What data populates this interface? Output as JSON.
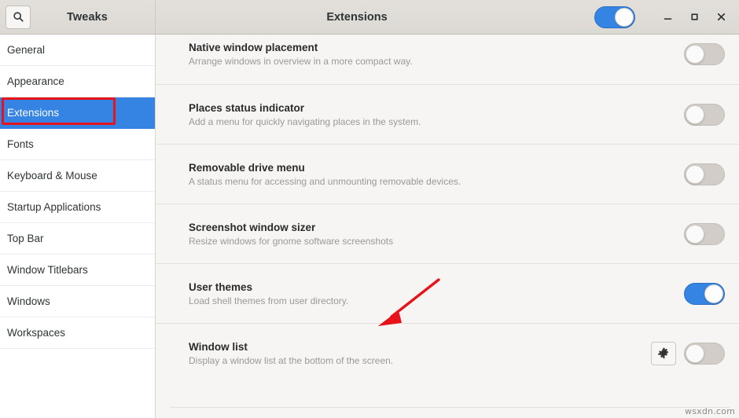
{
  "window": {
    "app_title": "Tweaks",
    "page_title": "Extensions",
    "search_icon": "search-icon",
    "master_toggle_on": true,
    "controls": {
      "minimize": "minimize-icon",
      "maximize": "maximize-icon",
      "close": "close-icon"
    }
  },
  "sidebar": {
    "items": [
      {
        "label": "General",
        "selected": false
      },
      {
        "label": "Appearance",
        "selected": false
      },
      {
        "label": "Extensions",
        "selected": true
      },
      {
        "label": "Fonts",
        "selected": false
      },
      {
        "label": "Keyboard & Mouse",
        "selected": false
      },
      {
        "label": "Startup Applications",
        "selected": false
      },
      {
        "label": "Top Bar",
        "selected": false
      },
      {
        "label": "Window Titlebars",
        "selected": false
      },
      {
        "label": "Windows",
        "selected": false
      },
      {
        "label": "Workspaces",
        "selected": false
      }
    ]
  },
  "extensions": [
    {
      "name": "Native window placement",
      "description": "Arrange windows in overview in a more compact way.",
      "enabled": false,
      "has_settings": false
    },
    {
      "name": "Places status indicator",
      "description": "Add a menu for quickly navigating places in the system.",
      "enabled": false,
      "has_settings": false
    },
    {
      "name": "Removable drive menu",
      "description": "A status menu for accessing and unmounting removable devices.",
      "enabled": false,
      "has_settings": false
    },
    {
      "name": "Screenshot window sizer",
      "description": "Resize windows for gnome software screenshots",
      "enabled": false,
      "has_settings": false
    },
    {
      "name": "User themes",
      "description": "Load shell themes from user directory.",
      "enabled": true,
      "has_settings": false
    },
    {
      "name": "Window list",
      "description": "Display a window list at the bottom of the screen.",
      "enabled": false,
      "has_settings": true
    }
  ],
  "annotations": {
    "highlight_target": "Extensions",
    "arrow_target": "User themes",
    "color": "#e8131a"
  },
  "watermark": "wsxdn.com",
  "colors": {
    "accent": "#3584e4",
    "titlebar": "#dfdcd8",
    "content_bg": "#f6f5f4",
    "sidebar_bg": "#ffffff",
    "annotation": "#e8131a"
  }
}
